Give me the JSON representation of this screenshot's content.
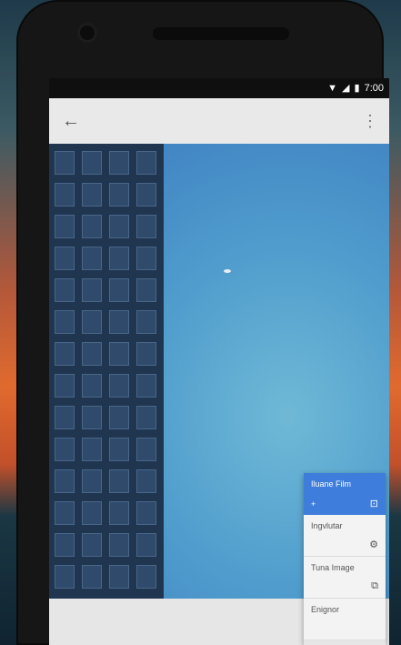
{
  "status_bar": {
    "time": "7:00",
    "icons": [
      "wifi-icon",
      "signal-icon",
      "battery-icon"
    ]
  },
  "app_bar": {
    "back_icon": "arrow-back-icon",
    "overflow_icon": "more-vert-icon"
  },
  "menu": {
    "items": [
      {
        "label": "Iluane Film",
        "sub": "+",
        "icon": "crop-icon",
        "active": true
      },
      {
        "label": "Ingvlutar",
        "icon": "settings-icon",
        "active": false
      },
      {
        "label": "Tuna Image",
        "icon": "image-icon",
        "active": false
      },
      {
        "label": "Enignor",
        "icon": "",
        "active": false
      }
    ],
    "accent_color": "#3f7ddc"
  }
}
